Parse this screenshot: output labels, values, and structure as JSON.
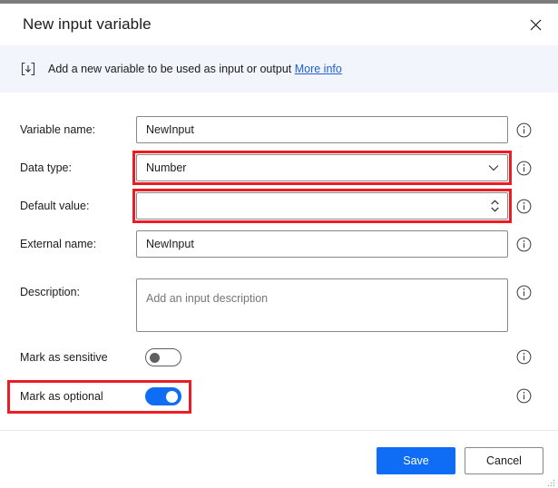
{
  "dialog": {
    "title": "New input variable",
    "close_icon": "close-icon"
  },
  "banner": {
    "icon": "input-variable-icon",
    "text": "Add a new variable to be used as input or output",
    "link_label": "More info"
  },
  "form": {
    "fields": [
      {
        "label": "Variable name:",
        "type": "text",
        "value": "NewInput",
        "placeholder": "",
        "highlighted": false,
        "info_icon": "info-icon"
      },
      {
        "label": "Data type:",
        "type": "dropdown",
        "value": "Number",
        "placeholder": "",
        "highlighted": true,
        "info_icon": "info-icon",
        "chevron_icon": "chevron-down-icon"
      },
      {
        "label": "Default value:",
        "type": "number",
        "value": "",
        "placeholder": "",
        "highlighted": true,
        "info_icon": "info-icon",
        "spinner_icon": "spinner-updown-icon"
      },
      {
        "label": "External name:",
        "type": "text",
        "value": "NewInput",
        "placeholder": "",
        "highlighted": false,
        "info_icon": "info-icon"
      },
      {
        "label": "Description:",
        "type": "textarea",
        "value": "",
        "placeholder": "Add an input description",
        "highlighted": false,
        "info_icon": "info-icon"
      }
    ],
    "toggles": [
      {
        "label": "Mark as sensitive",
        "state": "off",
        "highlighted": false,
        "info_icon": "info-icon"
      },
      {
        "label": "Mark as optional",
        "state": "on",
        "highlighted": true,
        "info_icon": "info-icon"
      }
    ]
  },
  "footer": {
    "save_label": "Save",
    "cancel_label": "Cancel"
  },
  "colors": {
    "accent_blue": "#0f6cf5",
    "link_blue": "#1f5fce",
    "highlight_red": "#ec1c24",
    "banner_bg": "#f2f6fc",
    "border_grey": "#8a8886",
    "window_edge": "#7b7b7b"
  }
}
